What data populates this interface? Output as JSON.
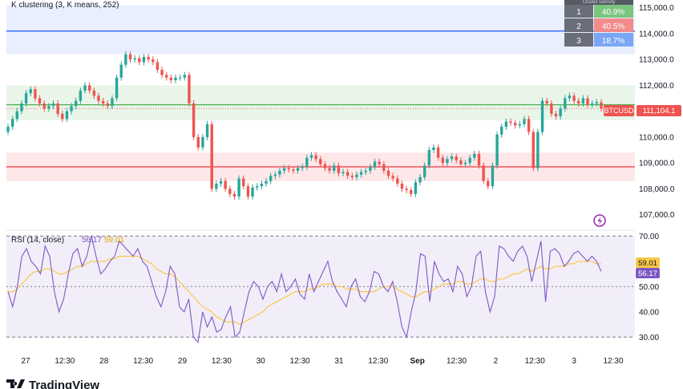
{
  "header": {
    "indicator_label": "K clustering (3, K means, 252)",
    "rsi_label": "RSI (14, close)",
    "rsi_value": "56.17",
    "rsi_ma_value": "59.01"
  },
  "cluster_table": {
    "header": "Cluster Density",
    "rows": [
      {
        "id": "1",
        "density": "40.9%",
        "color": "#7bc47f"
      },
      {
        "id": "2",
        "density": "40.5%",
        "color": "#f28b8b"
      },
      {
        "id": "3",
        "density": "18.7%",
        "color": "#7aa6f5"
      }
    ]
  },
  "price_tag": {
    "symbol": "BTCUSD",
    "value": "111,104.1"
  },
  "rsi_tags": {
    "ma": "59.01",
    "rsi": "56.17"
  },
  "logo": {
    "text": "TradingView"
  },
  "colors": {
    "up": "#26a69a",
    "down": "#ef5350",
    "band_blue": "#2962ff",
    "band_green": "#4caf50",
    "band_red": "#f23645",
    "rsi_line": "#7e57c2",
    "rsi_ma": "#f7c948"
  },
  "chart_data": [
    {
      "type": "candlestick",
      "title": "BTCUSD",
      "ylim": [
        106400,
        115300
      ],
      "y_ticks": [
        "115,000.0",
        "114,000.0",
        "113,000.0",
        "112,000.0",
        "111,000.0",
        "110,000.0",
        "109,000.0",
        "108,000.0",
        "107,000.0"
      ],
      "x_ticks": [
        "27",
        "12:30",
        "28",
        "12:30",
        "29",
        "12:30",
        "30",
        "12:30",
        "31",
        "12:30",
        "Sep",
        "12:30",
        "2",
        "12:30",
        "3",
        "12:30"
      ],
      "last_price": 111104.1,
      "cluster_levels": [
        {
          "name": "1",
          "level": 111250,
          "band": [
            110650,
            112000
          ],
          "color": "#4caf50"
        },
        {
          "name": "2",
          "level": 108850,
          "band": [
            108300,
            109400
          ],
          "color": "#f23645"
        },
        {
          "name": "3",
          "level": 114100,
          "band": [
            113200,
            115100
          ],
          "color": "#2962ff"
        }
      ],
      "close": [
        110400,
        110700,
        111000,
        111300,
        111700,
        111850,
        111500,
        111300,
        111100,
        111200,
        111300,
        110900,
        110700,
        111000,
        111200,
        111400,
        111800,
        112000,
        111800,
        111600,
        111400,
        111300,
        111200,
        111500,
        112300,
        112800,
        113200,
        113000,
        113050,
        112900,
        113100,
        113000,
        112900,
        112600,
        112400,
        112300,
        112200,
        112300,
        112300,
        112400,
        111300,
        110000,
        109600,
        110000,
        110500,
        108000,
        108200,
        108300,
        108000,
        107800,
        107700,
        108400,
        108100,
        107700,
        108050,
        108100,
        108200,
        108300,
        108500,
        108550,
        108700,
        108800,
        108750,
        108700,
        108800,
        108850,
        109200,
        109300,
        109150,
        108950,
        108800,
        108700,
        108900,
        108600,
        108650,
        108500,
        108450,
        108550,
        108650,
        108700,
        108850,
        109050,
        108950,
        108700,
        108500,
        108400,
        108200,
        108000,
        107950,
        107800,
        108250,
        108450,
        108900,
        109500,
        109600,
        109200,
        109000,
        109150,
        109250,
        109100,
        108950,
        109000,
        109200,
        109350,
        108900,
        108300,
        108100,
        108900,
        110100,
        110400,
        110600,
        110550,
        110450,
        110500,
        110700,
        110200,
        108800,
        110200,
        111400,
        111300,
        110900,
        110800,
        111100,
        111500,
        111600,
        111400,
        111300,
        111500,
        111250,
        111300,
        111350,
        111104
      ]
    },
    {
      "type": "line",
      "title": "RSI (14, close)",
      "ylim": [
        25,
        72
      ],
      "y_ticks": [
        "70.00",
        "60.00",
        "50.00",
        "40.00",
        "30.00"
      ],
      "bands": [
        70,
        50,
        30
      ],
      "series": [
        {
          "name": "RSI",
          "values": [
            48,
            42,
            50,
            62,
            65,
            60,
            58,
            55,
            66,
            62,
            48,
            40,
            45,
            55,
            63,
            65,
            58,
            62,
            70,
            62,
            55,
            57,
            60,
            62,
            68,
            66,
            64,
            62,
            65,
            60,
            58,
            52,
            46,
            42,
            48,
            58,
            55,
            42,
            40,
            45,
            30,
            28,
            40,
            34,
            38,
            32,
            33,
            38,
            42,
            30,
            32,
            40,
            48,
            52,
            50,
            45,
            50,
            52,
            48,
            55,
            48,
            50,
            53,
            47,
            45,
            55,
            48,
            52,
            56,
            60,
            52,
            48,
            45,
            42,
            50,
            53,
            46,
            44,
            48,
            56,
            55,
            50,
            48,
            52,
            44,
            34,
            30,
            40,
            48,
            63,
            62,
            44,
            60,
            55,
            52,
            53,
            48,
            58,
            55,
            46,
            50,
            62,
            64,
            48,
            40,
            46,
            66,
            65,
            62,
            60,
            64,
            66,
            62,
            52,
            60,
            68,
            44,
            64,
            65,
            63,
            58,
            60,
            63,
            64,
            62,
            60,
            62,
            60,
            56
          ]
        },
        {
          "name": "RSI-based MA",
          "values": [
            48,
            48,
            49,
            51,
            53,
            55,
            56,
            56,
            57,
            57,
            56,
            55,
            55,
            56,
            57,
            58,
            58,
            59,
            60,
            60,
            60,
            60,
            61,
            61,
            62,
            62,
            62,
            62,
            62,
            61,
            60,
            59,
            57,
            56,
            55,
            55,
            54,
            52,
            50,
            48,
            46,
            44,
            42,
            41,
            40,
            38,
            37,
            36,
            36,
            36,
            35,
            36,
            37,
            38,
            39,
            40,
            42,
            43,
            44,
            45,
            46,
            47,
            48,
            48,
            48,
            49,
            49,
            50,
            51,
            51,
            51,
            50,
            50,
            49,
            49,
            49,
            48,
            48,
            48,
            48,
            49,
            50,
            50,
            50,
            49,
            48,
            47,
            46,
            46,
            47,
            48,
            48,
            49,
            50,
            51,
            51,
            51,
            52,
            52,
            51,
            51,
            52,
            53,
            53,
            52,
            52,
            53,
            53,
            54,
            55,
            55,
            56,
            57,
            56,
            57,
            58,
            57,
            57,
            58,
            58,
            58,
            59,
            59,
            60,
            60,
            60,
            60,
            59,
            59
          ]
        }
      ]
    }
  ]
}
